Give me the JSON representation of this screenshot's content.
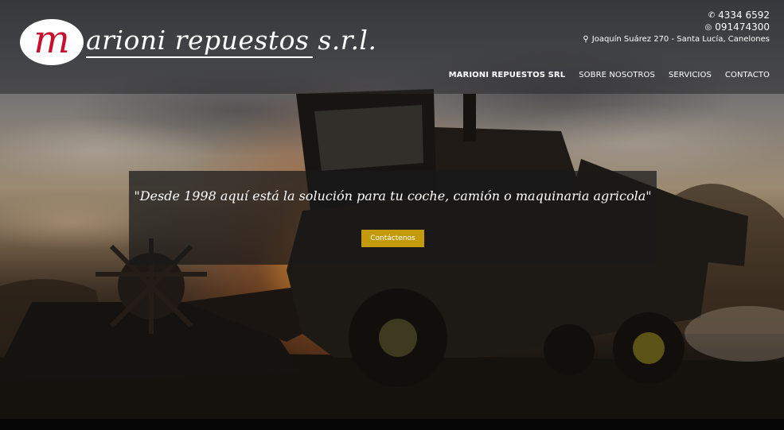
{
  "brand": {
    "logo_letter": "m",
    "logo_text": "arioni repuestos s.r.l.",
    "accent_red": "#c8102e"
  },
  "contact": {
    "phone": "4334 6592",
    "phone_icon": "phone-icon",
    "whatsapp": "091474300",
    "whatsapp_icon": "whatsapp-icon",
    "address": "Joaquín Suárez 270 - Santa Lucía, Canelones",
    "address_icon": "map-marker-icon"
  },
  "nav": {
    "items": [
      {
        "label": "MARIONI REPUESTOS SRL",
        "active": true
      },
      {
        "label": "SOBRE NOSOTROS",
        "active": false
      },
      {
        "label": "SERVICIOS",
        "active": false
      },
      {
        "label": "CONTACTO",
        "active": false
      }
    ]
  },
  "hero": {
    "tagline": "\"Desde 1998 aquí está la solución para tu coche, camión o maquinaria agricola\"",
    "cta_label": "Contáctenos",
    "cta_color": "#c49a0a"
  }
}
